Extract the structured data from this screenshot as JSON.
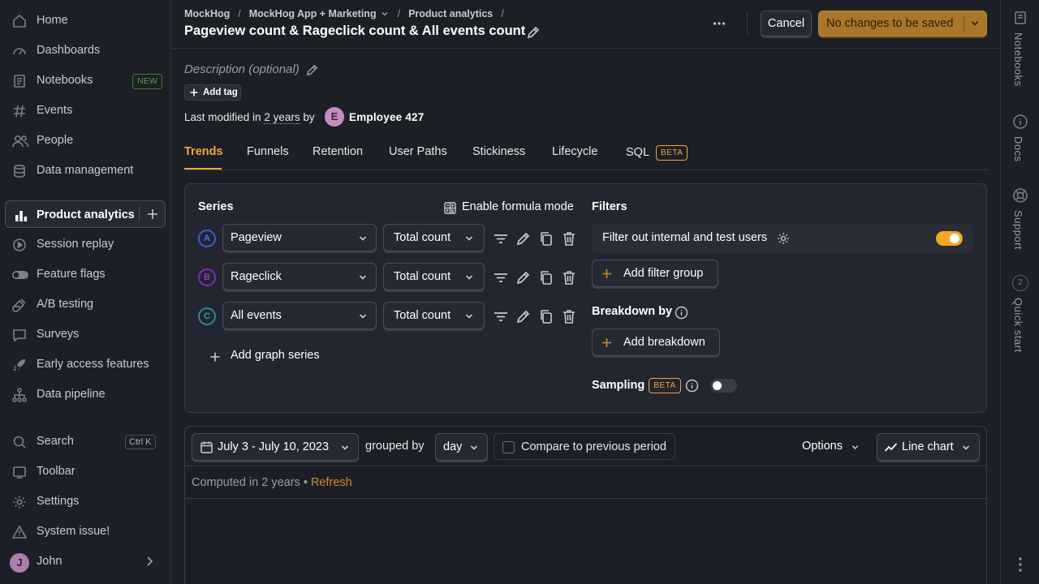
{
  "sidebar": {
    "items": [
      {
        "label": "Home",
        "icon": "home-icon"
      },
      {
        "label": "Dashboards",
        "icon": "dashboard-icon"
      },
      {
        "label": "Notebooks",
        "icon": "notebook-icon",
        "badge": "NEW"
      },
      {
        "label": "Events",
        "icon": "events-icon"
      },
      {
        "label": "People",
        "icon": "people-icon"
      },
      {
        "label": "Data management",
        "icon": "database-icon"
      },
      {
        "label": "Product analytics",
        "icon": "bar-chart-icon",
        "active": true
      },
      {
        "label": "Session replay",
        "icon": "replay-icon"
      },
      {
        "label": "Feature flags",
        "icon": "toggle-icon"
      },
      {
        "label": "A/B testing",
        "icon": "flask-icon"
      },
      {
        "label": "Surveys",
        "icon": "survey-icon"
      },
      {
        "label": "Early access features",
        "icon": "rocket-icon"
      },
      {
        "label": "Data pipeline",
        "icon": "pipeline-icon"
      }
    ],
    "bottom": {
      "search": {
        "label": "Search",
        "shortcut": "Ctrl K"
      },
      "toolbar": "Toolbar",
      "settings": "Settings",
      "system": "System issue!",
      "user": {
        "name": "John",
        "initial": "J"
      }
    }
  },
  "right_rail": {
    "notebooks": "Notebooks",
    "docs": "Docs",
    "support": "Support",
    "quick_start": "Quick start",
    "quick_start_count": "2"
  },
  "header": {
    "breadcrumbs": [
      "MockHog",
      "MockHog App + Marketing",
      "Product analytics"
    ],
    "title": "Pageview count & Rageclick count & All events count",
    "cancel_label": "Cancel",
    "save_label": "No changes to be saved"
  },
  "meta": {
    "description_placeholder": "Description (optional)",
    "add_tag": "Add tag",
    "modified_prefix": "Last modified in",
    "modified_when": "2 years",
    "modified_by": "by",
    "author_initial": "E",
    "author": "Employee 427"
  },
  "tabs": [
    {
      "label": "Trends",
      "active": true
    },
    {
      "label": "Funnels"
    },
    {
      "label": "Retention"
    },
    {
      "label": "User Paths"
    },
    {
      "label": "Stickiness"
    },
    {
      "label": "Lifecycle"
    },
    {
      "label": "SQL",
      "badge": "BETA"
    }
  ],
  "query": {
    "series_heading": "Series",
    "formula_mode": "Enable formula mode",
    "series": [
      {
        "letter": "A",
        "event": "Pageview",
        "math": "Total count",
        "color": "#3b5bdb"
      },
      {
        "letter": "B",
        "event": "Rageclick",
        "math": "Total count",
        "color": "#7b2cbf"
      },
      {
        "letter": "C",
        "event": "All events",
        "math": "Total count",
        "color": "#2b8a8a"
      }
    ],
    "add_series": "Add graph series",
    "filters_heading": "Filters",
    "test_users_label": "Filter out internal and test users",
    "test_users_enabled": true,
    "add_filter_group": "Add filter group",
    "breakdown_heading": "Breakdown by",
    "add_breakdown": "Add breakdown",
    "sampling_heading": "Sampling",
    "sampling_badge": "BETA",
    "sampling_enabled": false
  },
  "results": {
    "date_range": "July 3 - July 10, 2023",
    "grouped_by_label": "grouped by",
    "interval": "day",
    "compare_label": "Compare to previous period",
    "options_label": "Options",
    "chart_type": "Line chart",
    "computed_text": "Computed in 2 years",
    "separator": "•",
    "refresh": "Refresh"
  },
  "colors": {
    "accent": "#f0a53a",
    "save_button": "#a9762c",
    "background": "#1d1f27"
  }
}
